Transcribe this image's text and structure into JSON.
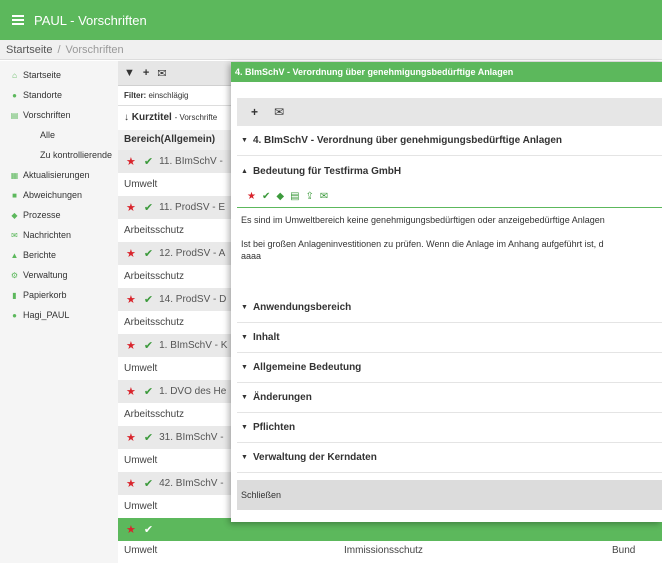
{
  "header": {
    "title": "PAUL - Vorschriften"
  },
  "breadcrumb": {
    "home": "Startseite",
    "separator": "/",
    "current": "Vorschriften"
  },
  "sidebar": {
    "items": [
      {
        "label": "Startseite",
        "icon": "home-icon"
      },
      {
        "label": "Standorte",
        "icon": "map-marker-icon"
      },
      {
        "label": "Vorschriften",
        "icon": "book-icon"
      },
      {
        "label": "Alle",
        "sub": true
      },
      {
        "label": "Zu kontrollierende",
        "sub": true
      },
      {
        "label": "Aktualisierungen",
        "icon": "calendar-icon"
      },
      {
        "label": "Abweichungen",
        "icon": "flag-icon"
      },
      {
        "label": "Prozesse",
        "icon": "tag-icon"
      },
      {
        "label": "Nachrichten",
        "icon": "envelope-icon"
      },
      {
        "label": "Berichte",
        "icon": "chart-icon"
      },
      {
        "label": "Verwaltung",
        "icon": "cogs-icon"
      },
      {
        "label": "Papierkorb",
        "icon": "trash-icon"
      },
      {
        "label": "Hagi_PAUL",
        "icon": "user-icon"
      }
    ]
  },
  "list": {
    "filter_label": "Filter:",
    "filter_value": "einschlägig",
    "sort_label": "Kurztitel",
    "sort_sub": "- Vorschrifte",
    "group": "Bereich(Allgemein)",
    "rows": [
      {
        "title": "11. BImSchV -",
        "area": "Umwelt"
      },
      {
        "title": "11. ProdSV - E",
        "area": "Arbeitsschutz"
      },
      {
        "title": "12. ProdSV - A",
        "area": "Arbeitsschutz"
      },
      {
        "title": "14. ProdSV - D",
        "area": "Arbeitsschutz"
      },
      {
        "title": "1. BImSchV - K",
        "area": "Umwelt"
      },
      {
        "title": "1. DVO des He",
        "area": "Arbeitsschutz"
      },
      {
        "title": "31. BImSchV -",
        "area": "Umwelt"
      },
      {
        "title": "42. BImSchV -",
        "area": "Umwelt"
      }
    ],
    "last_row": {
      "area": "Umwelt",
      "topic": "Immissionsschutz",
      "scope": "Bund"
    }
  },
  "modal": {
    "title": "4. BImSchV - Verordnung über genehmigungsbedürftige Anlagen",
    "sections": {
      "main": "4. BImSchV - Verordnung über genehmigungsbedürftige Anlagen",
      "bedeutung": "Bedeutung für Testfirma GmbH",
      "anwendungsbereich": "Anwendungsbereich",
      "inhalt": "Inhalt",
      "allgemeine": "Allgemeine Bedeutung",
      "aenderungen": "Änderungen",
      "pflichten": "Pflichten",
      "verwaltung": "Verwaltung der Kerndaten"
    },
    "text": {
      "p1": "Es sind im Umweltbereich keine genehmigungsbedürftigen oder anzeigebedürftige Anlagen",
      "p2": "Ist bei großen Anlageninvestitionen zu prüfen. Wenn die Anlage im Anhang aufgeführt ist, d",
      "p3": "aaaa"
    },
    "close_label": "Schließen"
  },
  "colors": {
    "accent": "#5cb85c",
    "star": "#d9242c",
    "check": "#3c9a3c"
  }
}
